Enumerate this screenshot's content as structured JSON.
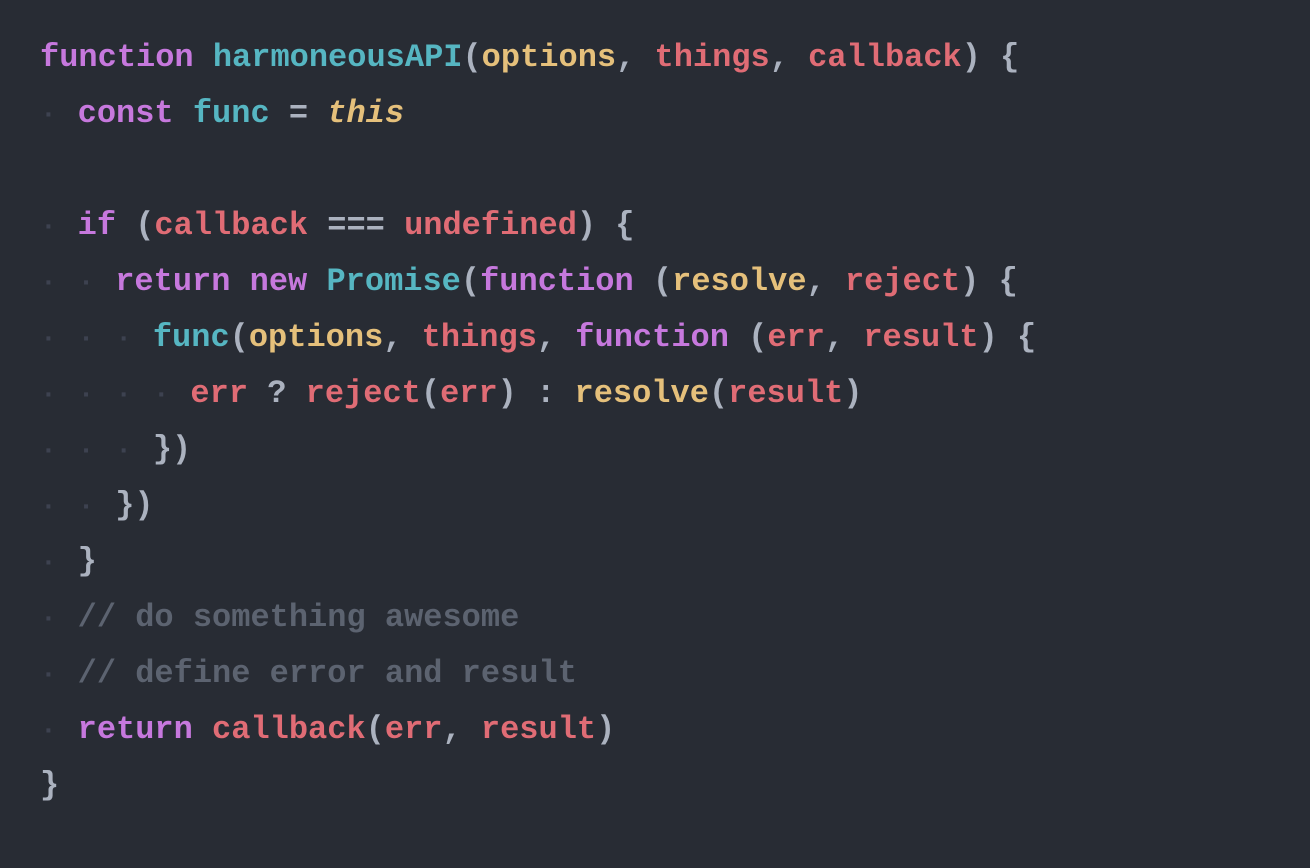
{
  "code": {
    "background": "#282c34",
    "lines": [
      {
        "id": "line1",
        "indent": "",
        "tokens": [
          {
            "text": "function ",
            "class": "kw-function"
          },
          {
            "text": "harmoneousAPI",
            "class": "kw-cyan"
          },
          {
            "text": "(",
            "class": "kw-paren"
          },
          {
            "text": "options",
            "class": "kw-orange"
          },
          {
            "text": ", ",
            "class": "kw-white"
          },
          {
            "text": "things",
            "class": "kw-pink"
          },
          {
            "text": ", ",
            "class": "kw-white"
          },
          {
            "text": "callback",
            "class": "kw-callback"
          },
          {
            "text": ") {",
            "class": "kw-white"
          }
        ]
      },
      {
        "id": "line2",
        "indent": "· ",
        "tokens": [
          {
            "text": "const ",
            "class": "kw-const"
          },
          {
            "text": "func",
            "class": "kw-cyan"
          },
          {
            "text": " = ",
            "class": "kw-equals"
          },
          {
            "text": "this",
            "class": "kw-this"
          }
        ]
      },
      {
        "id": "line3",
        "empty": true
      },
      {
        "id": "line4",
        "indent": "· ",
        "tokens": [
          {
            "text": "if ",
            "class": "kw-if"
          },
          {
            "text": "(",
            "class": "kw-paren"
          },
          {
            "text": "callback",
            "class": "kw-callback"
          },
          {
            "text": " === ",
            "class": "kw-white"
          },
          {
            "text": "undefined",
            "class": "kw-undefined"
          },
          {
            "text": ") {",
            "class": "kw-white"
          }
        ]
      },
      {
        "id": "line5",
        "indent": "· · ",
        "tokens": [
          {
            "text": "return ",
            "class": "kw-return"
          },
          {
            "text": "new ",
            "class": "kw-new"
          },
          {
            "text": "Promise",
            "class": "kw-cyan"
          },
          {
            "text": "(",
            "class": "kw-paren"
          },
          {
            "text": "function ",
            "class": "kw-function"
          },
          {
            "text": "(",
            "class": "kw-paren"
          },
          {
            "text": "resolve",
            "class": "kw-orange"
          },
          {
            "text": ", ",
            "class": "kw-white"
          },
          {
            "text": "reject",
            "class": "kw-pink"
          },
          {
            "text": ") {",
            "class": "kw-white"
          }
        ]
      },
      {
        "id": "line6",
        "indent": "· · · ",
        "tokens": [
          {
            "text": "func",
            "class": "kw-cyan"
          },
          {
            "text": "(",
            "class": "kw-paren"
          },
          {
            "text": "options",
            "class": "kw-orange"
          },
          {
            "text": ", ",
            "class": "kw-white"
          },
          {
            "text": "things",
            "class": "kw-pink"
          },
          {
            "text": ", ",
            "class": "kw-white"
          },
          {
            "text": "function ",
            "class": "kw-function"
          },
          {
            "text": "(",
            "class": "kw-paren"
          },
          {
            "text": "err",
            "class": "kw-err"
          },
          {
            "text": ", ",
            "class": "kw-white"
          },
          {
            "text": "result",
            "class": "kw-pink"
          },
          {
            "text": ") {",
            "class": "kw-white"
          }
        ]
      },
      {
        "id": "line7",
        "indent": "· · · · ",
        "tokens": [
          {
            "text": "err",
            "class": "kw-err"
          },
          {
            "text": " ? ",
            "class": "kw-white"
          },
          {
            "text": "reject",
            "class": "kw-pink"
          },
          {
            "text": "(",
            "class": "kw-paren"
          },
          {
            "text": "err",
            "class": "kw-err"
          },
          {
            "text": ") : ",
            "class": "kw-white"
          },
          {
            "text": "resolve",
            "class": "kw-orange"
          },
          {
            "text": "(",
            "class": "kw-paren"
          },
          {
            "text": "result",
            "class": "kw-pink"
          },
          {
            "text": ")",
            "class": "kw-white"
          }
        ]
      },
      {
        "id": "line8",
        "indent": "· · · ",
        "tokens": [
          {
            "text": "})",
            "class": "kw-white"
          }
        ]
      },
      {
        "id": "line9",
        "indent": "· · ",
        "tokens": [
          {
            "text": "})",
            "class": "kw-white"
          }
        ]
      },
      {
        "id": "line10",
        "indent": "· ",
        "tokens": [
          {
            "text": "}",
            "class": "kw-white"
          }
        ]
      },
      {
        "id": "line11",
        "indent": "· ",
        "tokens": [
          {
            "text": "// do something awesome",
            "class": "kw-comment"
          }
        ]
      },
      {
        "id": "line12",
        "indent": "· ",
        "tokens": [
          {
            "text": "// define error and result",
            "class": "kw-comment"
          }
        ]
      },
      {
        "id": "line13",
        "indent": "· ",
        "tokens": [
          {
            "text": "return ",
            "class": "kw-return"
          },
          {
            "text": "callback",
            "class": "kw-callback"
          },
          {
            "text": "(",
            "class": "kw-paren"
          },
          {
            "text": "err",
            "class": "kw-err"
          },
          {
            "text": ", ",
            "class": "kw-white"
          },
          {
            "text": "result",
            "class": "kw-pink"
          },
          {
            "text": ")",
            "class": "kw-white"
          }
        ]
      },
      {
        "id": "line14",
        "indent": "",
        "tokens": [
          {
            "text": "}",
            "class": "kw-white"
          }
        ]
      }
    ]
  }
}
